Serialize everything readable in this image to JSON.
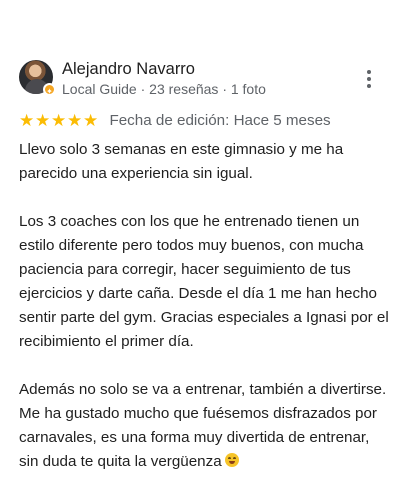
{
  "reviewer": {
    "name": "Alejandro Navarro",
    "meta": "Local Guide · 23 reseñas · 1 foto",
    "avatar_icon": "profile-photo",
    "badge_icon": "local-guide-badge"
  },
  "actions": {
    "more_icon": "more-vertical-icon"
  },
  "rating": {
    "stars": 5,
    "max_stars": 5,
    "star_color": "#fbbc04",
    "edit_date": "Fecha de edición: Hace 5 meses"
  },
  "review": {
    "paragraphs": [
      {
        "lines": [
          "Llevo solo 3 semanas en este gimnasio y me ha",
          "parecido una experiencia sin igual."
        ]
      },
      {
        "lines": [
          "Los 3 coaches con los que he entrenado tienen un",
          "estilo diferente pero todos muy buenos, con mucha",
          "paciencia para corregir, hacer seguimiento de tus",
          "ejercicios y darte caña. Desde el día 1 me han hecho",
          "sentir parte del gym. Gracias especiales a Ignasi por el",
          "recibimiento el primer día."
        ]
      },
      {
        "lines": [
          "Además no solo se va a entrenar, también a divertirse.",
          "Me ha gustado mucho que fuésemos disfrazados por",
          "carnavales, es una forma muy divertida de entrenar,",
          "sin duda te quita la vergüenza"
        ],
        "ending_emoji": "laughing-face-emoji"
      }
    ]
  },
  "colors": {
    "primary_text": "#1f1f1f",
    "secondary_text": "#5f6368",
    "background": "#ffffff"
  }
}
